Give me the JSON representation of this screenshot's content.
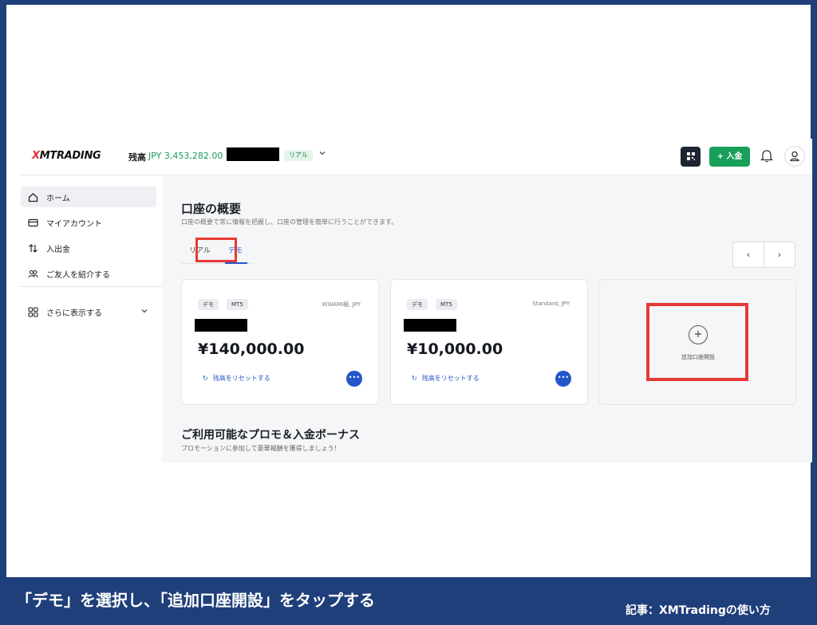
{
  "header": {
    "logo_mark": "X",
    "logo_text": "MTRADING",
    "balance_label": "残高",
    "balance_value": "JPY 3,453,282.00",
    "account_badge": "リアル",
    "deposit_label": "+ 入金",
    "colors": {
      "deposit": "#18a05a",
      "balance": "#1a9b5a"
    }
  },
  "sidebar": {
    "items": [
      {
        "label": "ホーム",
        "icon": "home-icon"
      },
      {
        "label": "マイアカウント",
        "icon": "card-icon"
      },
      {
        "label": "入出金",
        "icon": "transfer-icon"
      },
      {
        "label": "ご友人を紹介する",
        "icon": "people-icon"
      }
    ],
    "more_label": "さらに表示する"
  },
  "main": {
    "title": "口座の概要",
    "subtitle": "口座の概要で常に情報を把握し、口座の管理を簡単に行うことができます。",
    "tabs": [
      {
        "label": "リアル"
      },
      {
        "label": "デモ"
      }
    ],
    "cards": [
      {
        "chip1": "デモ",
        "chip2": "MT5",
        "type": "KIWAMI極, JPY",
        "amount": "¥140,000.00",
        "reset": "残高をリセットする"
      },
      {
        "chip1": "デモ",
        "chip2": "MT5",
        "type": "Standard, JPY",
        "amount": "¥10,000.00",
        "reset": "残高をリセットする"
      }
    ],
    "add_account_label": "追加口座開設",
    "promo_title": "ご利用可能なプロモ＆入金ボーナス",
    "promo_subtitle": "プロモーションに参加して豪華報酬を獲得しましょう！"
  },
  "caption": {
    "text": "「デモ」を選択し、「追加口座開設」をタップする",
    "credit": "記事：XMTradingの使い方"
  },
  "colors": {
    "highlight": "#e53935",
    "band": "#1f3f7a",
    "accent": "#2456c8"
  }
}
